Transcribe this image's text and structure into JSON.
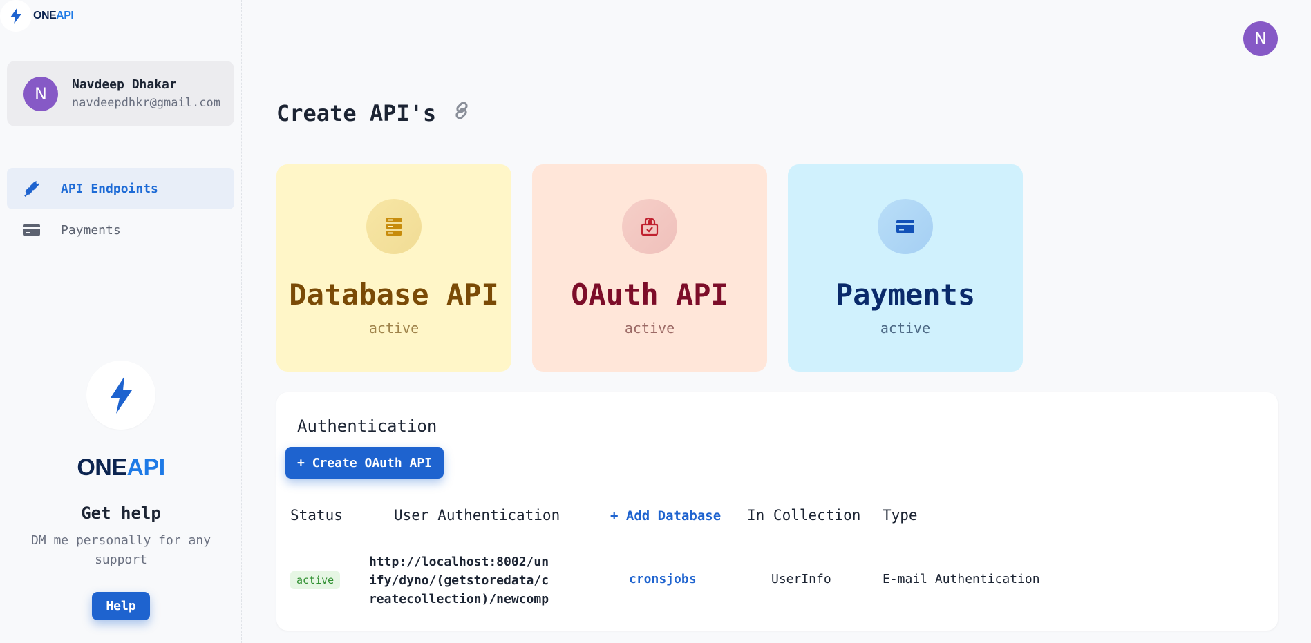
{
  "brand": {
    "one": "ONE",
    "api": "API"
  },
  "user": {
    "initial": "N",
    "name": "Navdeep Dhakar",
    "email": "navdeepdhkr@gmail.com"
  },
  "nav": {
    "items": [
      {
        "label": "API Endpoints",
        "icon": "plug-icon",
        "active": true
      },
      {
        "label": "Payments",
        "icon": "credit-card-icon",
        "active": false
      }
    ]
  },
  "help": {
    "title": "Get help",
    "text": "DM me personally for any support",
    "button": "Help"
  },
  "page": {
    "title": "Create API's"
  },
  "cards": [
    {
      "title": "Database API",
      "status": "active",
      "icon": "database-icon"
    },
    {
      "title": "OAuth API",
      "status": "active",
      "icon": "lock-icon"
    },
    {
      "title": "Payments",
      "status": "active",
      "icon": "credit-card-icon"
    }
  ],
  "auth": {
    "title": "Authentication",
    "create_button": "+ Create OAuth API",
    "columns": {
      "status": "Status",
      "user_auth": "User Authentication",
      "add_db": "+ Add Database",
      "collection": "In Collection",
      "type": "Type"
    },
    "rows": [
      {
        "status": "active",
        "url": "http://localhost:8002/unify/dyno/(getstoredata/createcollection)/newcomp",
        "database": "cronsjobs",
        "collection": "UserInfo",
        "type": "E-mail Authentication"
      }
    ]
  },
  "colors": {
    "accent": "#1e63cf",
    "avatar": "#8659c6",
    "db_card": "#fff6c8",
    "oauth_card": "#ffe6d9",
    "payments_card": "#d0f1fd"
  }
}
